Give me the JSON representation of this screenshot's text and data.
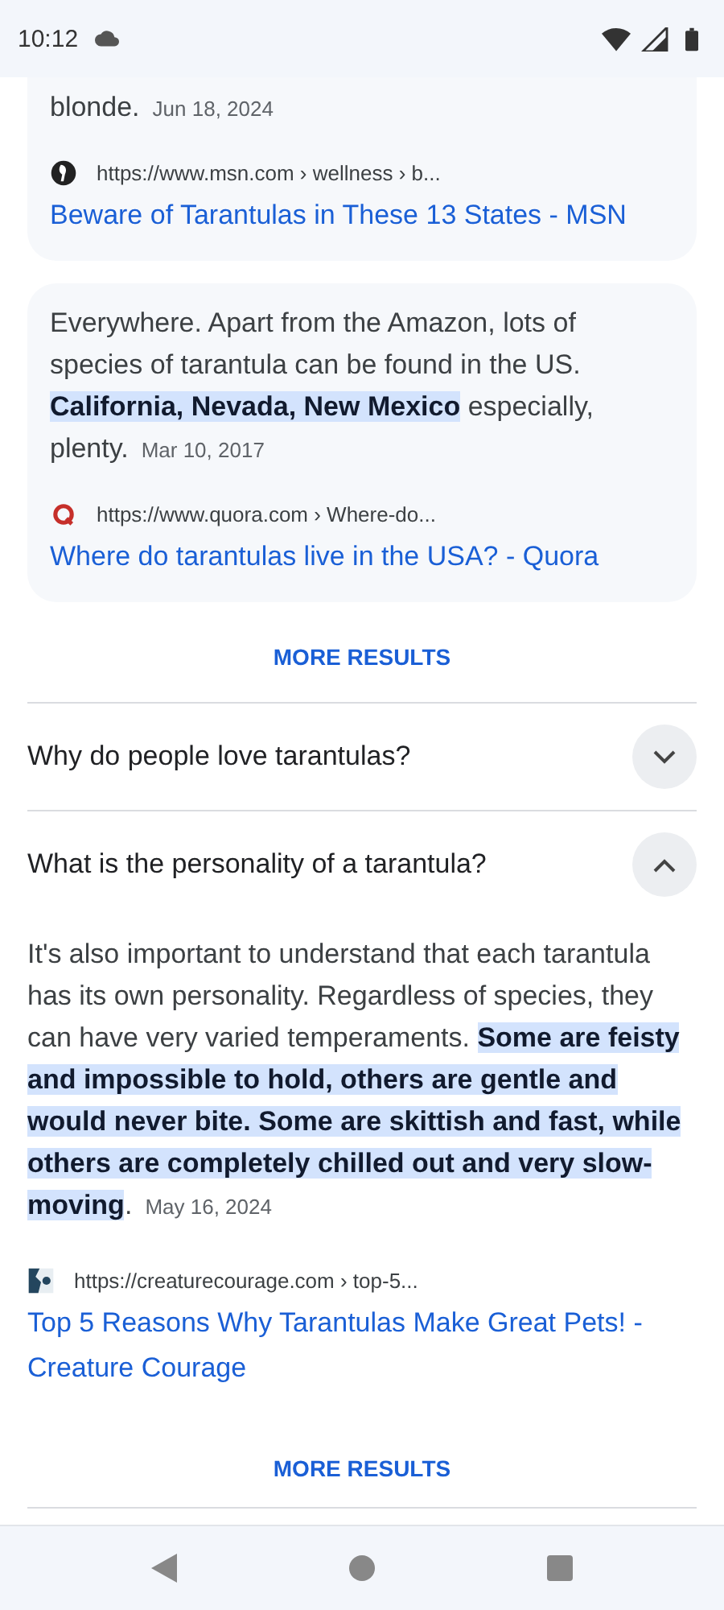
{
  "status_bar": {
    "time": "10:12"
  },
  "results": [
    {
      "snippet": [
        {
          "text": "blonde.",
          "highlighted": false
        }
      ],
      "date": "Jun 18, 2024",
      "favicon": {
        "kind": "msn"
      },
      "url": "https://www.msn.com › wellness › b...",
      "title": "Beware of Tarantulas in These 13 States - MSN",
      "cut_top": true
    },
    {
      "snippet": [
        {
          "text": "Everywhere. Apart from the Amazon, lots of species of tarantula can be found in the US. ",
          "highlighted": false
        },
        {
          "text": "California, Nevada, New Mexico",
          "highlighted": true
        },
        {
          "text": " especially, plenty.",
          "highlighted": false
        }
      ],
      "date": "Mar 10, 2017",
      "favicon": {
        "kind": "quora"
      },
      "url": "https://www.quora.com › Where-do...",
      "title": "Where do tarantulas live in the USA? - Quora",
      "cut_top": false
    }
  ],
  "more_results_top": "MORE RESULTS",
  "questions": [
    {
      "question": "Why do people love tarantulas?",
      "expanded": false
    },
    {
      "question": "What is the personality of a tarantula?",
      "expanded": true,
      "answer": {
        "snippet": [
          {
            "text": "It's also important to understand that each tarantula has its own personality. Regardless of species, they can have very varied temperaments. ",
            "highlighted": false
          },
          {
            "text": "Some are feisty and impossible to hold, others are gentle and would never bite.",
            "highlighted": true
          },
          {
            "text": " Some are skittish and fast, while others are completely chilled out and very slow-moving",
            "highlighted": true
          },
          {
            "text": ".",
            "highlighted": false
          }
        ],
        "date": "May 16, 2024",
        "favicon": {
          "kind": "creature"
        },
        "url": "https://creaturecourage.com › top-5...",
        "title": "Top 5 Reasons Why Tarantulas Make Great Pets! - Creature Courage",
        "more": "MORE RESULTS"
      }
    }
  ]
}
